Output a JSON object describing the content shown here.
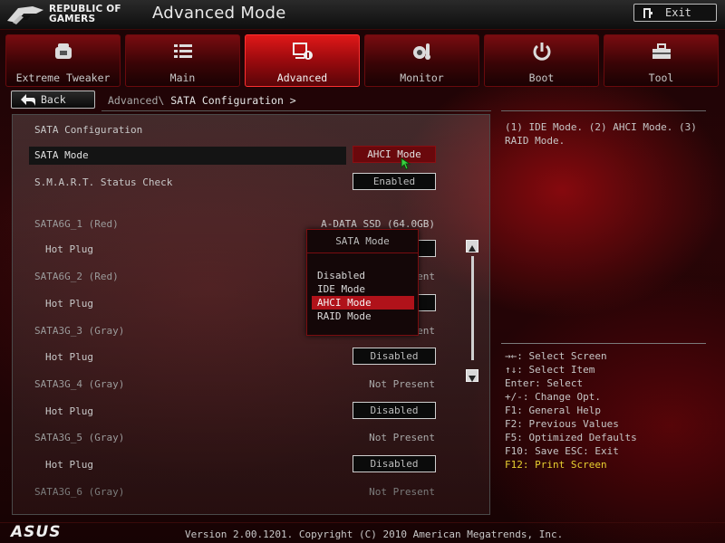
{
  "header": {
    "brand_line1": "REPUBLIC OF",
    "brand_line2": "GAMERS",
    "title": "Advanced Mode",
    "exit_label": "Exit"
  },
  "tabs": [
    {
      "label": "Extreme Tweaker",
      "icon": "tweaker-icon",
      "active": false
    },
    {
      "label": "Main",
      "icon": "list-icon",
      "active": false
    },
    {
      "label": "Advanced",
      "icon": "advanced-icon",
      "active": true
    },
    {
      "label": "Monitor",
      "icon": "monitor-icon",
      "active": false
    },
    {
      "label": "Boot",
      "icon": "power-icon",
      "active": false
    },
    {
      "label": "Tool",
      "icon": "toolbox-icon",
      "active": false
    }
  ],
  "nav": {
    "back_label": "Back",
    "crumb_parent": "Advanced\\",
    "crumb_current": "SATA Configuration >"
  },
  "panel": {
    "section_title": "SATA Configuration",
    "rows": [
      {
        "label": "SATA Mode",
        "option": "AHCI Mode"
      },
      {
        "label": "S.M.A.R.T. Status Check",
        "option": "Enabled"
      },
      {
        "label": "SATA6G_1 (Red)",
        "value": "A-DATA SSD (64.0GB)"
      },
      {
        "label": "Hot Plug",
        "option": ""
      },
      {
        "label": "SATA6G_2 (Red)",
        "value": "Not Present"
      },
      {
        "label": "Hot Plug",
        "option": ""
      },
      {
        "label": "SATA3G_3 (Gray)",
        "value": "Not Present"
      },
      {
        "label": "Hot Plug",
        "option": "Disabled"
      },
      {
        "label": "SATA3G_4 (Gray)",
        "value": "Not Present"
      },
      {
        "label": "Hot Plug",
        "option": "Disabled"
      },
      {
        "label": "SATA3G_5 (Gray)",
        "value": "Not Present"
      },
      {
        "label": "Hot Plug",
        "option": "Disabled"
      },
      {
        "label": "SATA3G_6 (Gray)",
        "value": "Not Present"
      }
    ],
    "partial_values": [
      "esent",
      "esent"
    ]
  },
  "popup": {
    "title": "SATA Mode",
    "options": [
      "Disabled",
      "IDE Mode",
      "AHCI Mode",
      "RAID Mode"
    ],
    "highlighted": "AHCI Mode"
  },
  "help": {
    "description": "(1) IDE Mode. (2) AHCI Mode. (3)\nRAID Mode."
  },
  "keys": [
    "→←: Select Screen",
    "↑↓: Select Item",
    "Enter: Select",
    "+/-: Change Opt.",
    "F1: General Help",
    "F2: Previous Values",
    "F5: Optimized Defaults",
    "F10: Save  ESC: Exit",
    "F12: Print Screen"
  ],
  "footer": {
    "brand": "ASUS",
    "version": "Version 2.00.1201. Copyright (C) 2010 American Megatrends, Inc."
  },
  "colors": {
    "accent": "#d4141c",
    "highlight_key": "#e8d030"
  }
}
